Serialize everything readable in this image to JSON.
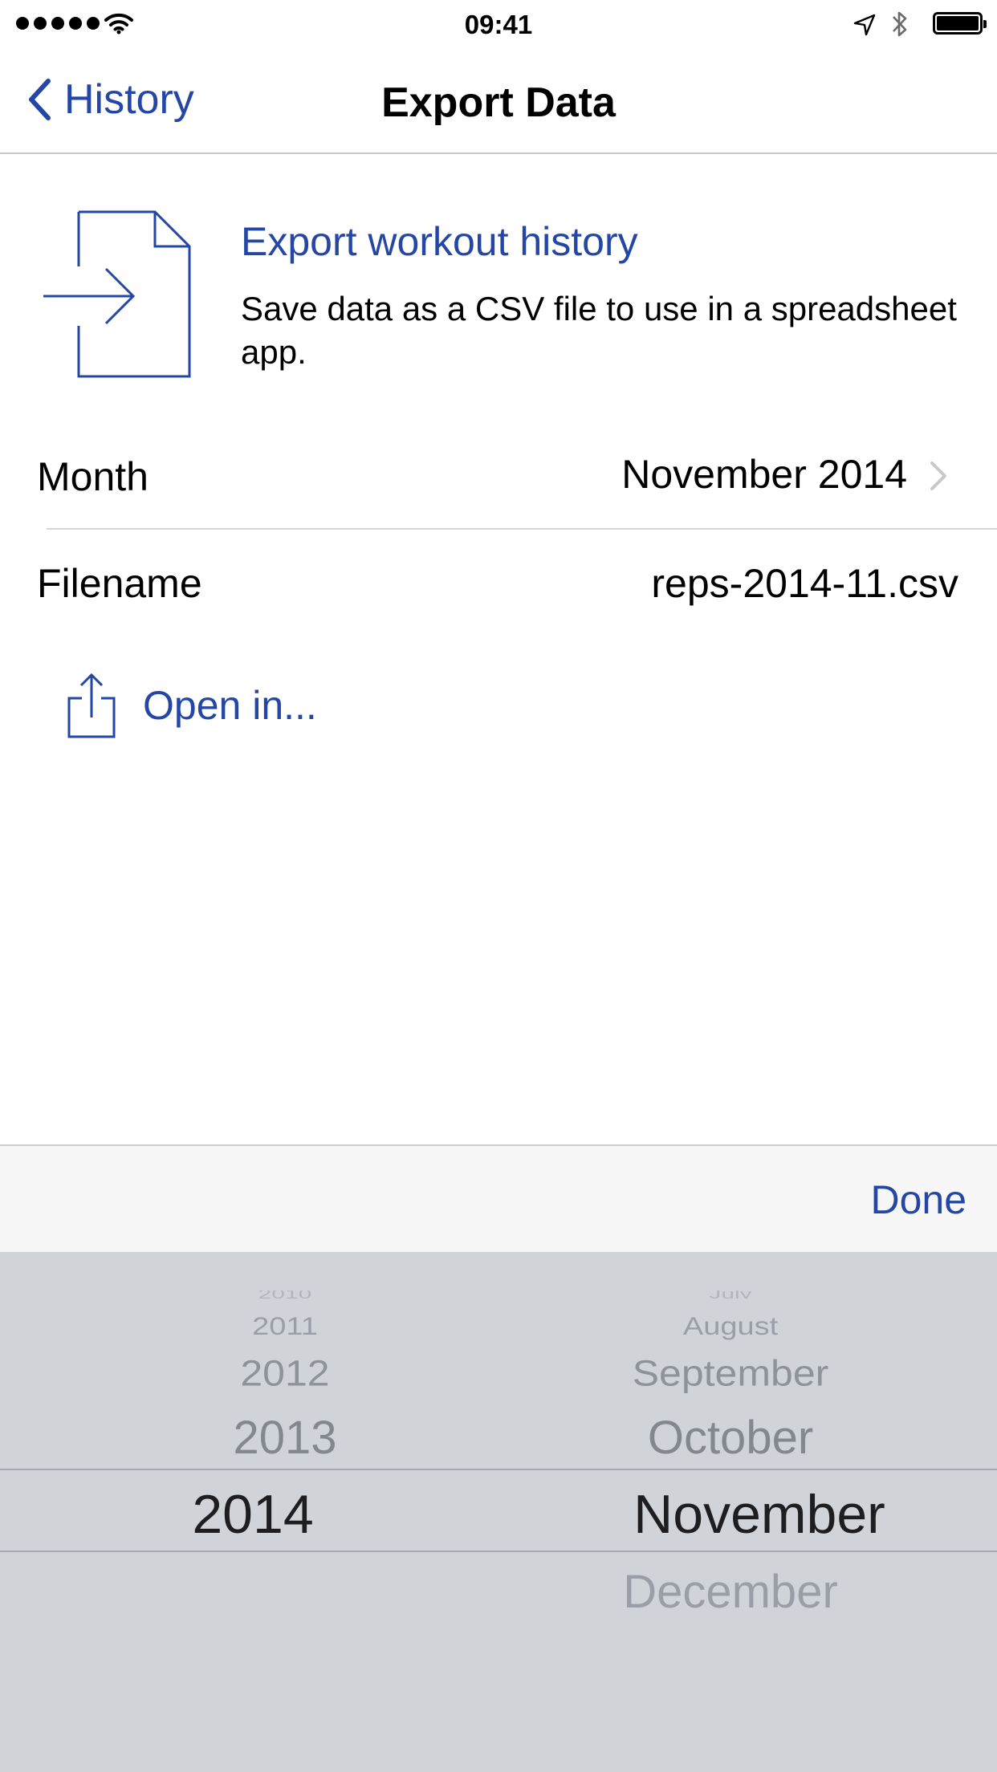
{
  "status_bar": {
    "time": "09:41",
    "icons": [
      "signal-dots-icon",
      "wifi-icon",
      "location-arrow-icon",
      "bluetooth-icon",
      "battery-icon"
    ]
  },
  "nav": {
    "back_label": "History",
    "title": "Export Data"
  },
  "header": {
    "title": "Export workout history",
    "description": "Save data as a CSV file to use in a spreadsheet app."
  },
  "rows": {
    "month": {
      "label": "Month",
      "value": "November 2014"
    },
    "filename": {
      "label": "Filename",
      "value": "reps-2014-11.csv"
    }
  },
  "open_in": {
    "label": "Open in..."
  },
  "toolbar": {
    "done_label": "Done"
  },
  "picker": {
    "years": [
      "2010",
      "2011",
      "2012",
      "2013",
      "2014"
    ],
    "selected_year": "2014",
    "months": [
      "July",
      "August",
      "September",
      "October",
      "November",
      "December"
    ],
    "selected_month": "November"
  },
  "colors": {
    "accent": "#2447a6",
    "picker_background": "#d0d4d9",
    "toolbar_background": "#f7f7f7"
  }
}
